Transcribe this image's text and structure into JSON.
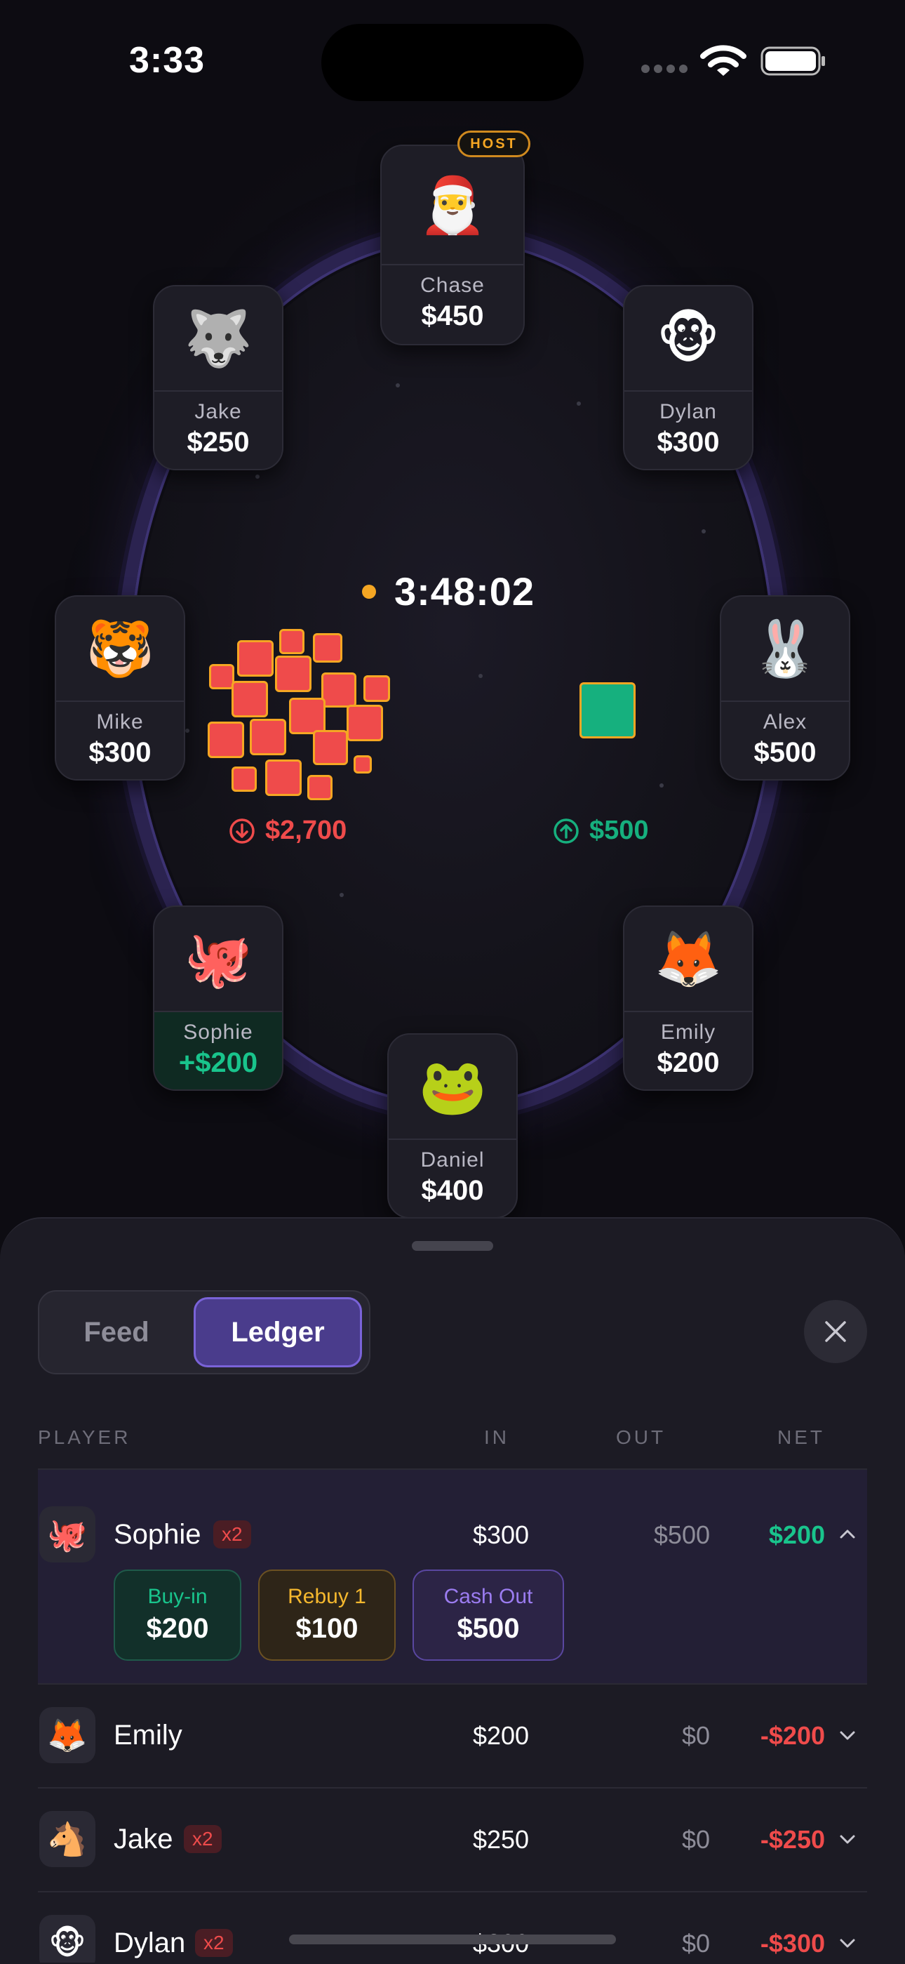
{
  "status_bar": {
    "time": "3:33"
  },
  "table": {
    "timer": "3:48:02",
    "host_badge": "HOST",
    "pot_in": "$2,700",
    "pot_out": "$500"
  },
  "seats": [
    {
      "key": "chase",
      "emoji": "🎅",
      "name": "Chase",
      "amount": "$450"
    },
    {
      "key": "jake",
      "emoji": "🐺",
      "name": "Jake",
      "amount": "$250"
    },
    {
      "key": "dylan",
      "emoji": "🐵",
      "name": "Dylan",
      "amount": "$300"
    },
    {
      "key": "mike",
      "emoji": "🐯",
      "name": "Mike",
      "amount": "$300"
    },
    {
      "key": "alex",
      "emoji": "🐰",
      "name": "Alex",
      "amount": "$500"
    },
    {
      "key": "sophie",
      "emoji": "🐙",
      "name": "Sophie",
      "amount": "+$200"
    },
    {
      "key": "emily",
      "emoji": "🦊",
      "name": "Emily",
      "amount": "$200"
    },
    {
      "key": "daniel",
      "emoji": "🐸",
      "name": "Daniel",
      "amount": "$400"
    }
  ],
  "sheet": {
    "tabs": {
      "feed": "Feed",
      "ledger": "Ledger"
    },
    "columns": {
      "player": "PLAYER",
      "in": "IN",
      "out": "OUT",
      "net": "NET"
    },
    "rows": [
      {
        "emoji": "🐙",
        "name": "Sophie",
        "badge": "x2",
        "in": "$300",
        "out": "$500",
        "net": "$200",
        "net_color": "#19c48c"
      },
      {
        "emoji": "🦊",
        "name": "Emily",
        "badge": "",
        "in": "$200",
        "out": "$0",
        "net": "-$200",
        "net_color": "#ef4b4b"
      },
      {
        "emoji": "🐴",
        "name": "Jake",
        "badge": "x2",
        "in": "$250",
        "out": "$0",
        "net": "-$250",
        "net_color": "#ef4b4b"
      },
      {
        "emoji": "🐵",
        "name": "Dylan",
        "badge": "x2",
        "in": "$300",
        "out": "$0",
        "net": "-$300",
        "net_color": "#ef4b4b"
      }
    ],
    "transactions": [
      {
        "label": "Buy-in",
        "amount": "$200",
        "color": "#19c48c"
      },
      {
        "label": "Rebuy 1",
        "amount": "$100",
        "color": "#f5b82e"
      },
      {
        "label": "Cash Out",
        "amount": "$500",
        "color": "#9b7cf0"
      }
    ]
  }
}
